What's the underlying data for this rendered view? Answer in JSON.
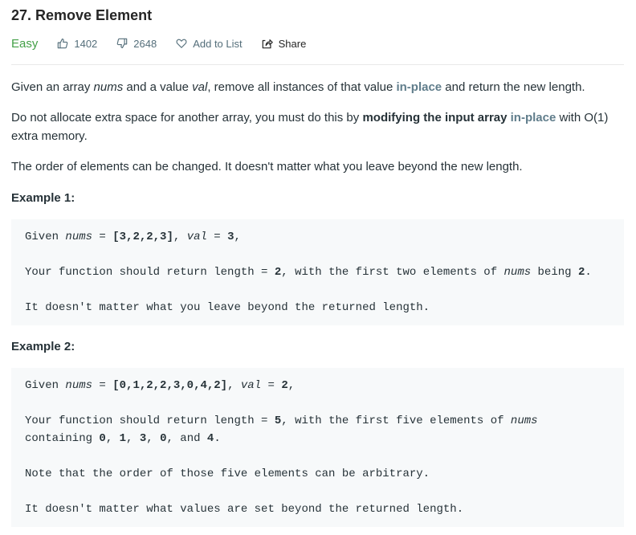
{
  "problem": {
    "title": "27. Remove Element",
    "difficulty": "Easy",
    "likes": "1402",
    "dislikes": "2648",
    "add_to_list": "Add to List",
    "share": "Share"
  },
  "description": {
    "p1": {
      "a": "Given an array ",
      "b": "nums",
      "c": " and a value ",
      "d": "val",
      "e": ", remove all instances of that value ",
      "f": "in-place",
      "g": " and return the new length."
    },
    "p2": {
      "a": "Do not allocate extra space for another array, you must do this by ",
      "b": "modifying the input array",
      "c": " ",
      "d": "in-place",
      "e": " with O(1) extra memory."
    },
    "p3": "The order of elements can be changed. It doesn't matter what you leave beyond the new length."
  },
  "example1": {
    "heading": "Example 1:",
    "l1": {
      "a": "Given ",
      "b": "nums",
      "c": " = ",
      "d": "[3,2,2,3]",
      "e": ", ",
      "f": "val",
      "g": " = ",
      "h": "3",
      "i": ","
    },
    "l2": {
      "a": "Your function should return length = ",
      "b": "2",
      "c": ", with the first two elements of ",
      "d": "nums",
      "e": " being ",
      "f": "2",
      "g": "."
    },
    "l3": "It doesn't matter what you leave beyond the returned length."
  },
  "example2": {
    "heading": "Example 2:",
    "l1": {
      "a": "Given ",
      "b": "nums",
      "c": " = ",
      "d": "[0,1,2,2,3,0,4,2]",
      "e": ", ",
      "f": "val",
      "g": " = ",
      "h": "2",
      "i": ","
    },
    "l2": {
      "a": "Your function should return length = ",
      "b": "5",
      "c": ", with the first five elements of ",
      "d": "nums"
    },
    "l3": {
      "a": "containing ",
      "b": "0",
      "c": ", ",
      "d": "1",
      "e": ", ",
      "f": "3",
      "g": ", ",
      "h": "0",
      "i": ", and ",
      "j": "4",
      "k": "."
    },
    "l4": "Note that the order of those five elements can be arbitrary.",
    "l5": "It doesn't matter what values are set beyond the returned length."
  },
  "colors": {
    "easy": "#43a047",
    "highlight": "#607d8b",
    "code_bg": "#f7f9fa",
    "meta_text": "#546e7a"
  },
  "icons": [
    "thumbs-up-icon",
    "thumbs-down-icon",
    "heart-icon",
    "share-icon"
  ]
}
